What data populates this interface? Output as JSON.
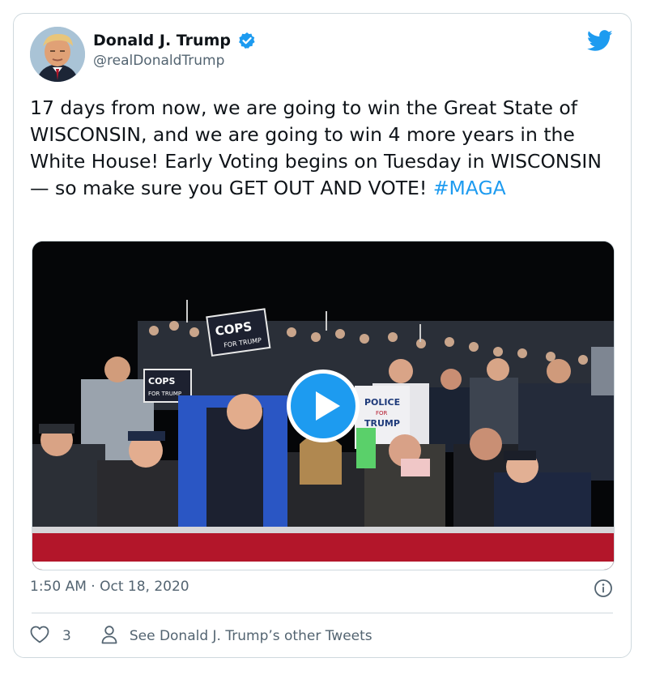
{
  "tweet": {
    "author": {
      "display_name": "Donald J. Trump",
      "handle": "@realDonaldTrump",
      "avatar_icon": "profile-photo",
      "verified_icon": "verified-badge-icon"
    },
    "brand_icon": "twitter-bird-icon",
    "text": "17 days from now, we are going to win the Great State of WISCONSIN, and we are going to win 4 more years in the White House! Early Voting begins on Tuesday in WISCONSIN — so make sure you GET OUT AND VOTE!",
    "hashtag": "#MAGA",
    "media": {
      "type": "video",
      "play_icon": "play-icon",
      "signs": [
        "COPS",
        "FOR TRUMP",
        "COPS",
        "FOR TRUMP",
        "POLICE",
        "FOR",
        "TRUMP"
      ]
    },
    "timestamp": "1:50 AM · Oct 18, 2020",
    "like_count": "3",
    "other_tweets_label": "See Donald J. Trump’s other Tweets"
  },
  "colors": {
    "accent": "#1d9bf0",
    "text": "#0f1419",
    "muted": "#536471",
    "border": "#cfd9de",
    "barrier_red": "#b3162a"
  }
}
